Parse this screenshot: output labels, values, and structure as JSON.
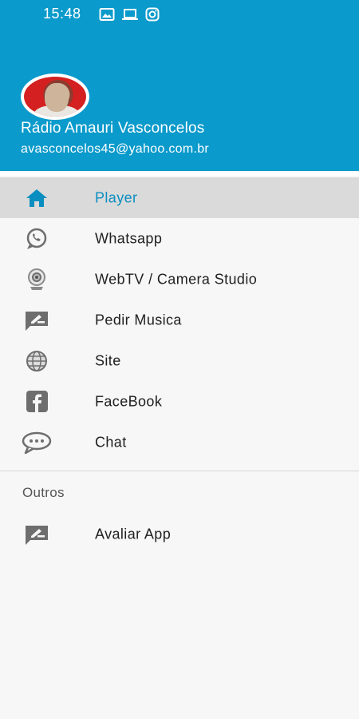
{
  "status_bar": {
    "time": "15:48",
    "icons": [
      "image-icon",
      "laptop-icon",
      "instagram-icon"
    ]
  },
  "header": {
    "background_color": "#0a9acb",
    "name": "Rádio Amauri Vasconcelos",
    "email": "avasconcelos45@yahoo.com.br"
  },
  "menu": {
    "items": [
      {
        "label": "Player",
        "icon": "home-icon",
        "active": true
      },
      {
        "label": "Whatsapp",
        "icon": "whatsapp-icon",
        "active": false
      },
      {
        "label": "WebTV / Camera Studio",
        "icon": "webcam-icon",
        "active": false
      },
      {
        "label": "Pedir Musica",
        "icon": "rate-review-icon",
        "active": false
      },
      {
        "label": "Site",
        "icon": "globe-icon",
        "active": false
      },
      {
        "label": "FaceBook",
        "icon": "facebook-icon",
        "active": false
      },
      {
        "label": "Chat",
        "icon": "chat-bubble-icon",
        "active": false
      }
    ]
  },
  "outros": {
    "title": "Outros",
    "items": [
      {
        "label": "Avaliar App",
        "icon": "rate-review-icon"
      }
    ]
  },
  "colors": {
    "accent": "#0a8ec0",
    "active_background": "#dadada",
    "icon_grey": "#6e6e6e"
  }
}
